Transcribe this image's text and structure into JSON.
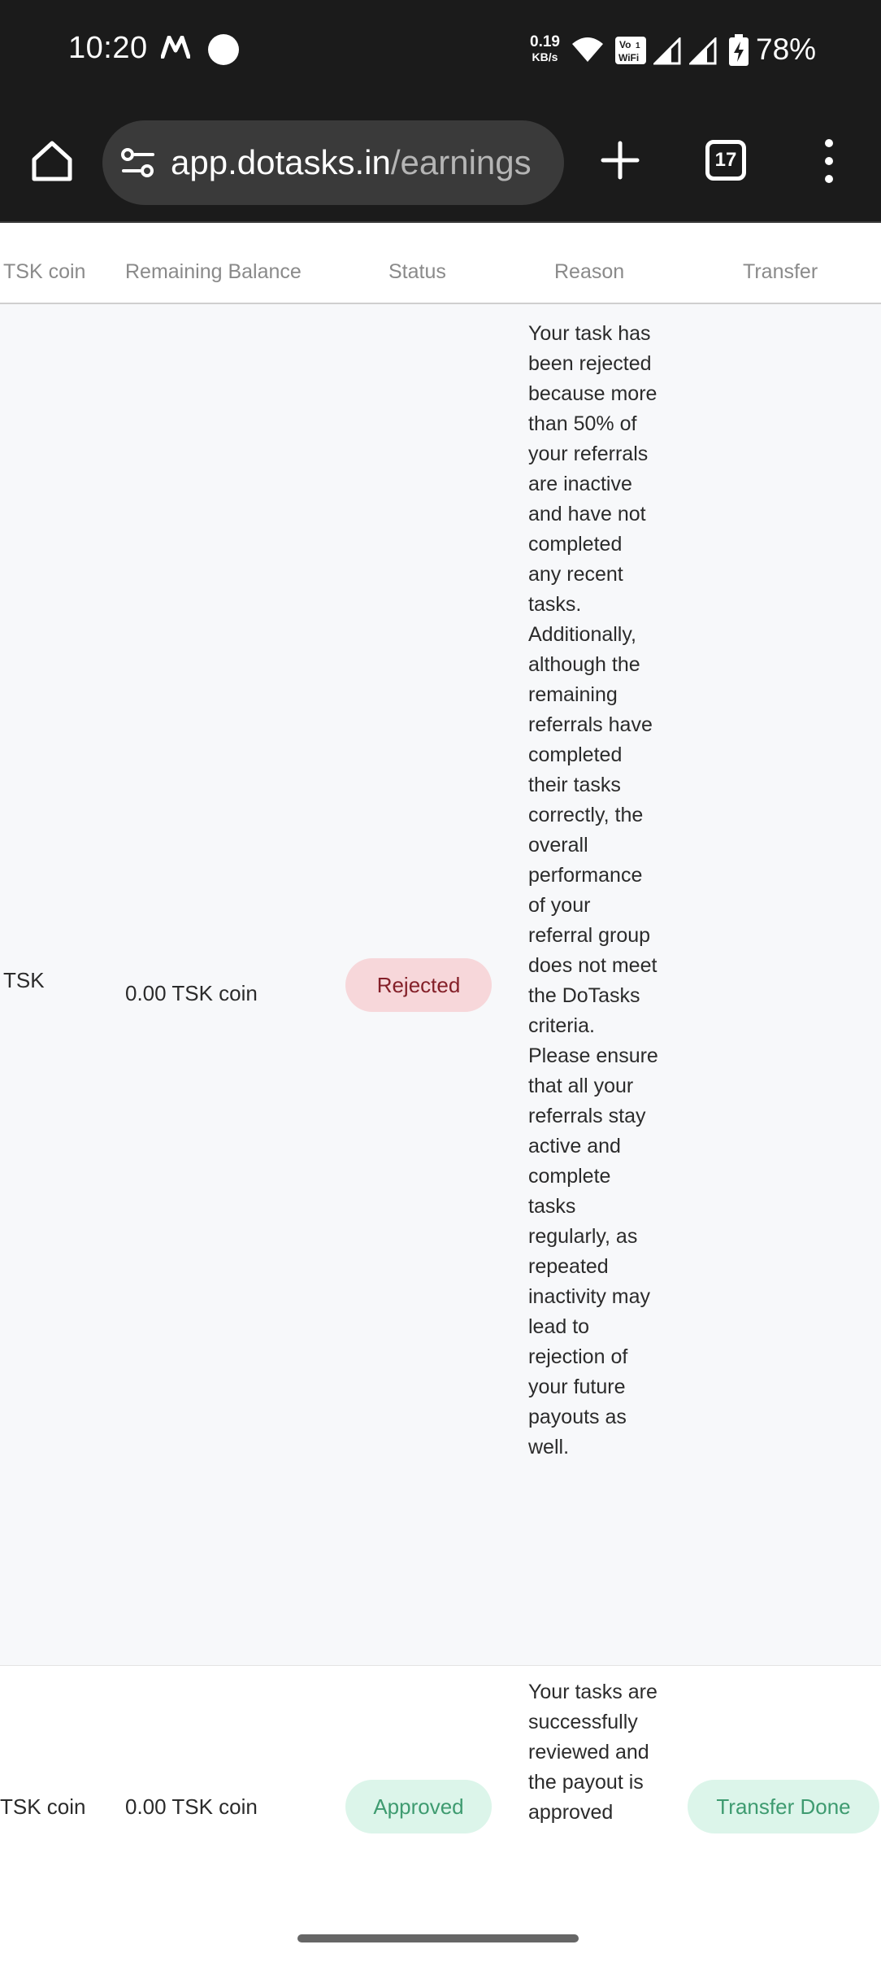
{
  "status_bar": {
    "time": "10:20",
    "net_speed_value": "0.19",
    "net_speed_unit": "KB/s",
    "volte_label_top": "Vo",
    "volte_label_bottom": "WiFi",
    "volte_sim": "1",
    "battery": "78%"
  },
  "browser": {
    "url_host": "app.dotasks.in",
    "url_path": "/earnings",
    "tab_count": "17"
  },
  "table": {
    "headers": [
      "TSK coin",
      "Remaining Balance",
      "Status",
      "Reason",
      "Transfer"
    ],
    "rows": [
      {
        "amount": "TSK",
        "remaining": "0.00 TSK coin",
        "status": "Rejected",
        "reason": "Your task has been rejected because more than 50% of your referrals are inactive and have not completed any recent tasks. Additionally, although the remaining referrals have completed their tasks correctly, the overall performance of your referral group does not meet the DoTasks criteria. Please ensure that all your referrals stay active and complete tasks regularly, as repeated inactivity may lead to rejection of your future payouts as well.",
        "transfer": ""
      },
      {
        "amount": "TSK coin",
        "remaining": "0.00 TSK coin",
        "status": "Approved",
        "reason": "Your tasks are successfully reviewed and the payout is approved",
        "transfer": "Transfer Done"
      }
    ]
  },
  "colors": {
    "rejected_bg": "#f7d7da",
    "rejected_text": "#842029",
    "approved_bg": "#dcf5ea",
    "approved_text": "#3e9b70"
  },
  "icons": [
    "m-icon",
    "circle-notification-icon",
    "wifi-icon",
    "volte-wifi-icon",
    "signal-icon",
    "battery-charging-icon",
    "home-icon",
    "site-settings-icon",
    "new-tab-icon",
    "tab-switcher-icon",
    "more-menu-icon"
  ]
}
